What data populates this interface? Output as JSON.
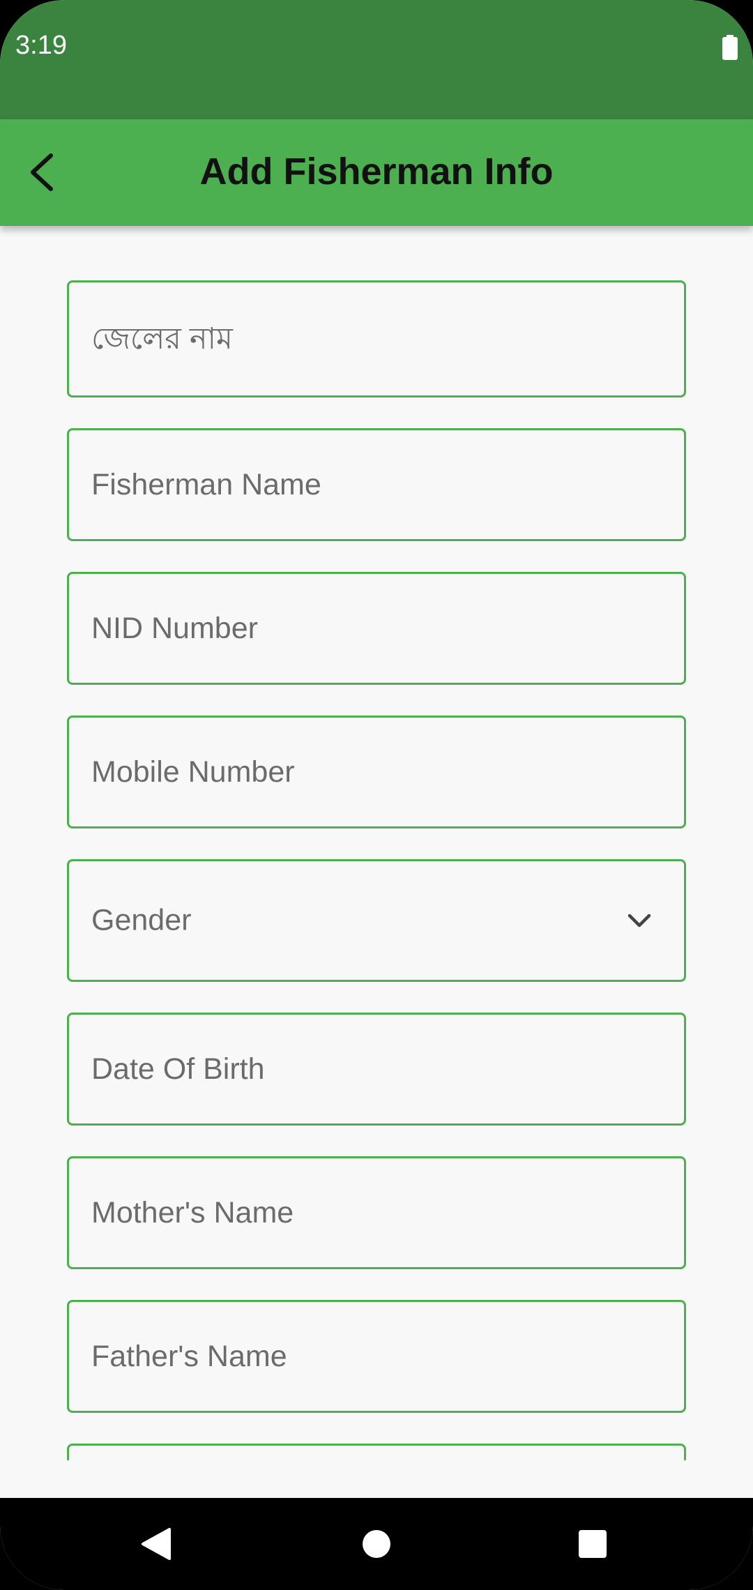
{
  "status_bar": {
    "time": "3:19",
    "battery_icon": "battery-full-icon"
  },
  "app_bar": {
    "back_icon": "chevron-left-icon",
    "title": "Add Fisherman Info",
    "color": "#4caf50"
  },
  "form": {
    "fields": [
      {
        "placeholder": "জেলের নাম"
      },
      {
        "placeholder": "Fisherman Name"
      },
      {
        "placeholder": "NID Number"
      },
      {
        "placeholder": "Mobile Number"
      },
      {
        "select_label": "Gender",
        "icon": "chevron-down-icon"
      },
      {
        "placeholder": "Date Of Birth"
      },
      {
        "placeholder": "Mother's Name"
      },
      {
        "placeholder": "Father's Name"
      }
    ],
    "border_color": "#4caf50"
  },
  "colors": {
    "status_bar": "#3a843f",
    "app_bar": "#4caf50",
    "field_border": "#4caf50",
    "background": "#f8f8f8"
  },
  "nav_bar": {
    "back_icon": "nav-back-icon",
    "home_icon": "nav-home-icon",
    "recents_icon": "nav-recents-icon"
  }
}
